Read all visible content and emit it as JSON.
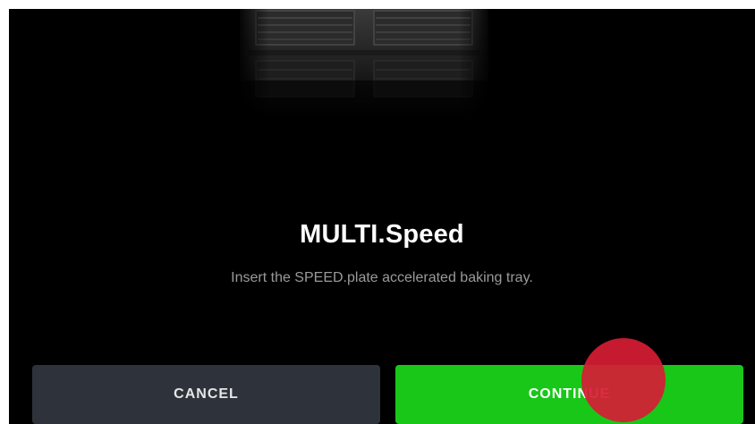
{
  "dialog": {
    "title": "MULTI.Speed",
    "message": "Insert the SPEED.plate accelerated baking tray."
  },
  "actions": {
    "cancel_label": "CANCEL",
    "continue_label": "CONTINUE"
  },
  "colors": {
    "background": "#000000",
    "cancel_button": "#2e333b",
    "continue_button": "#19c719",
    "touch_indicator": "#d61c34"
  },
  "icons": {
    "hero": "baking-tray-image"
  }
}
